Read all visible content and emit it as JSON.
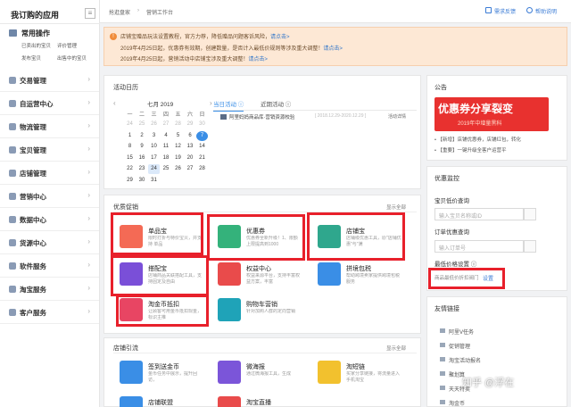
{
  "sidebar": {
    "title": "我订购的应用",
    "collapse_label": "≡",
    "common_title": "常用操作",
    "quick_links": [
      "已卖出的宝贝",
      "评价管理",
      "发布宝贝",
      "出售中的宝贝"
    ],
    "menu": [
      {
        "label": "交易管理"
      },
      {
        "label": "自运营中心"
      },
      {
        "label": "物流管理"
      },
      {
        "label": "宝贝管理"
      },
      {
        "label": "店铺管理"
      },
      {
        "label": "营销中心"
      },
      {
        "label": "数据中心"
      },
      {
        "label": "货源中心"
      },
      {
        "label": "软件服务"
      },
      {
        "label": "淘宝服务"
      },
      {
        "label": "客户服务"
      }
    ]
  },
  "topbar": {
    "breadcrumb_home": "抢逛盘家",
    "breadcrumb_sep": "›",
    "breadcrumb_current": "营销工作台",
    "feedback": "需求反馈",
    "help": "帮助说明"
  },
  "notice": {
    "lines": [
      {
        "text": "店铺宝赠品玩法设置教程，官方力荐，降低赠品问题客诉风险，",
        "link": "请点击>"
      },
      {
        "text": "2019年4月25日起，优惠券有效期，创建数量，是否计入最低价规则等涉及重大调整！",
        "link": "请点击>"
      },
      {
        "text": "2019年4月25日起，营销活动中店铺宝涉及重大调整！",
        "link": "请点击>"
      }
    ]
  },
  "calendar": {
    "title": "活动日历",
    "month": "七月 2019",
    "weekdays": [
      "一",
      "二",
      "三",
      "四",
      "五",
      "六",
      "日"
    ],
    "weeks": [
      [
        "24",
        "25",
        "26",
        "27",
        "28",
        "29",
        "30"
      ],
      [
        "1",
        "2",
        "3",
        "4",
        "5",
        "6",
        "7"
      ],
      [
        "8",
        "9",
        "10",
        "11",
        "12",
        "13",
        "14"
      ],
      [
        "15",
        "16",
        "17",
        "18",
        "19",
        "20",
        "21"
      ],
      [
        "22",
        "23",
        "24",
        "25",
        "26",
        "27",
        "28"
      ],
      [
        "29",
        "30",
        "31",
        "",
        "",
        "",
        "",
        ""
      ]
    ],
    "today": "7",
    "tab_today": "当日活动",
    "tab_recent": "近期活动",
    "event_title": "阿里妈妈商品库·营销资源校验",
    "event_date": "[ 2018.12.29-2020.12.29 ]",
    "event_more": "活动详情"
  },
  "tools": {
    "title": "优质促销",
    "toggle": "显示全部",
    "items": [
      {
        "name": "单品宝",
        "desc": "限时打折与特价宝贝，并支持 单品"
      },
      {
        "name": "优惠券",
        "desc": "优惠券全新升级！1、限额上限提高到1000"
      },
      {
        "name": "店铺宝",
        "desc": "店铺级优惠工具，原\"店铺优惠\"与\"满"
      },
      {
        "name": "搭配宝",
        "desc": "店铺商品关联搭配工具，支持固定及自由"
      },
      {
        "name": "权益中心",
        "desc": "权益来源平台，支持丰富权益方案，丰富"
      },
      {
        "name": "拼境包税",
        "desc": "帮助跨境卖家提供跨境包税服务"
      },
      {
        "name": "淘金币抵扣",
        "desc": "让顾客可用金币抵扣现金，标识主推"
      },
      {
        "name": "购物车营销",
        "desc": "针对加购人群的定向营销"
      }
    ]
  },
  "shop_traffic": {
    "title": "店铺引流",
    "toggle": "显示全部",
    "items": [
      {
        "name": "签到送金币",
        "desc": "金币任务中展示，提升回访，"
      },
      {
        "name": "微海报",
        "desc": "通过微海报工具，生成"
      },
      {
        "name": "淘短链",
        "desc": "买家分享链接，将流量进入手机淘宝"
      },
      {
        "name": "店铺联盟",
        "desc": ""
      },
      {
        "name": "淘宝直播",
        "desc": ""
      }
    ]
  },
  "announcement": {
    "title": "公告",
    "banner_main": "优惠券分享裂变",
    "banner_sub": "2019年中增量黑科",
    "items": [
      "【新增】店铺优惠券，店铺红包，转化",
      "【重要】一键升级全客户运营平"
    ]
  },
  "monitor": {
    "title": "优惠监控",
    "q1": "宝贝低价查询",
    "q1_placeholder": "输入宝贝名称或ID",
    "q2": "订单优惠查询",
    "q2_placeholder": "输入订单号",
    "q3": "最低价格设置",
    "note": "商品最低价折扣阀门",
    "set": "设置"
  },
  "friend_links": {
    "title": "友情链接",
    "items": [
      "阿里V任务",
      "促销管理",
      "淘宝活动报名",
      "聚划算",
      "天天特卖",
      "淘金币"
    ]
  },
  "watermark": "知乎 @浮在",
  "colors": {
    "accent": "#3a8ee6",
    "highlight": "#e8202b",
    "banner": "#e8312f"
  }
}
